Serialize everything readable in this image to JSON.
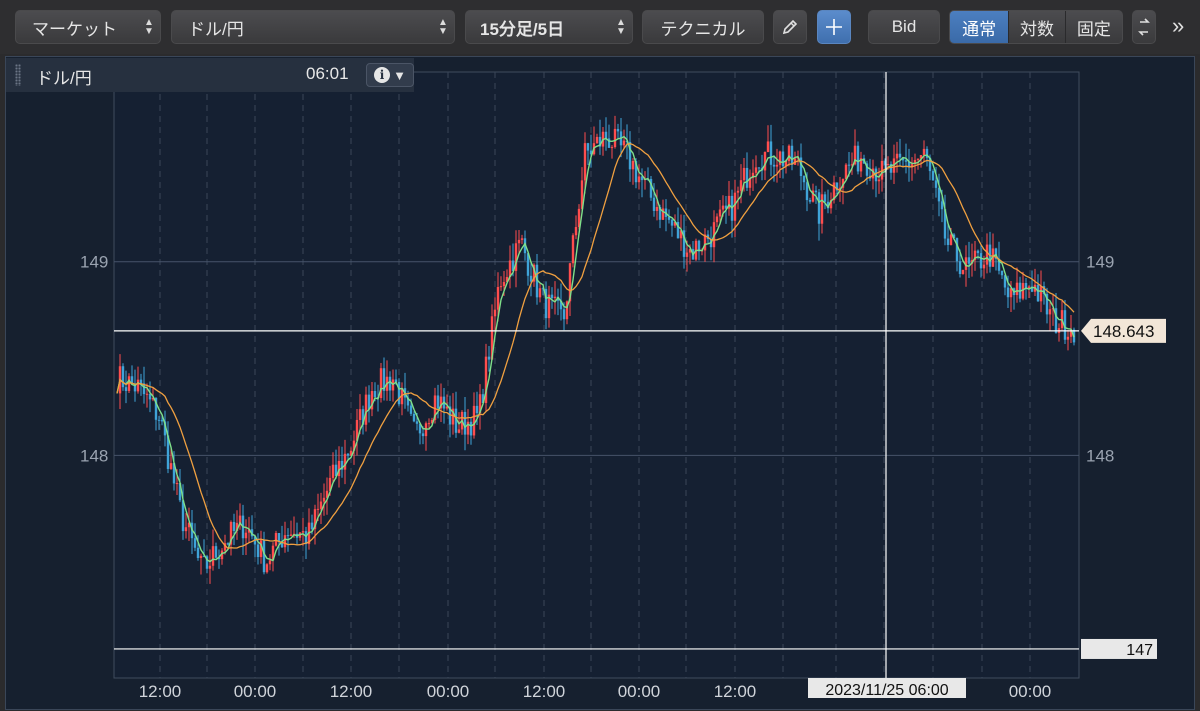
{
  "toolbar": {
    "market_select": "マーケット",
    "pair_select": "ドル/円",
    "period_select": "15分足/5日",
    "technical_button": "テクニカル",
    "pen_icon": "pencil-icon",
    "crosshair_icon": "crosshair-icon",
    "bid_button": "Bid",
    "scale_modes": [
      {
        "label": "通常",
        "active": true
      },
      {
        "label": "対数",
        "active": false
      },
      {
        "label": "固定",
        "active": false
      }
    ],
    "overflow_icon": "double-chevron-right-icon"
  },
  "info_bar": {
    "symbol": "ドル/円",
    "time": "06:01"
  },
  "chart_data": {
    "type": "candlestick",
    "ylim": [
      146.85,
      149.98
    ],
    "y_ticks": [
      "149",
      "148"
    ],
    "x_ticks": [
      "12:00",
      "00:00",
      "12:00",
      "00:00",
      "12:00",
      "00:00",
      "12:00",
      "00:00"
    ],
    "current_price": "148.643",
    "min_level_label": "147",
    "crosshair_time": "2023/11/25 06:00",
    "price_path": [
      148.4,
      148.35,
      148.2,
      147.7,
      147.4,
      147.55,
      147.65,
      147.45,
      147.62,
      147.58,
      147.85,
      148.05,
      148.35,
      148.4,
      148.1,
      148.3,
      148.15,
      148.2,
      148.9,
      149.1,
      148.8,
      148.7,
      149.55,
      149.65,
      149.55,
      149.35,
      149.2,
      149.05,
      149.15,
      149.3,
      149.55,
      149.55,
      149.5,
      149.25,
      149.45,
      149.55,
      149.45,
      149.5,
      149.55,
      149.1,
      148.95,
      149.05,
      148.8,
      148.9,
      148.7,
      148.66
    ],
    "colors": {
      "up": "#ff4d4d",
      "down": "#3fa3d8",
      "short_ma": "#7fe08a",
      "long_ma": "#f0a040",
      "grid": "#3a4658",
      "price_line": "#ffffff",
      "price_tag_bg": "#f2e6d8"
    }
  }
}
